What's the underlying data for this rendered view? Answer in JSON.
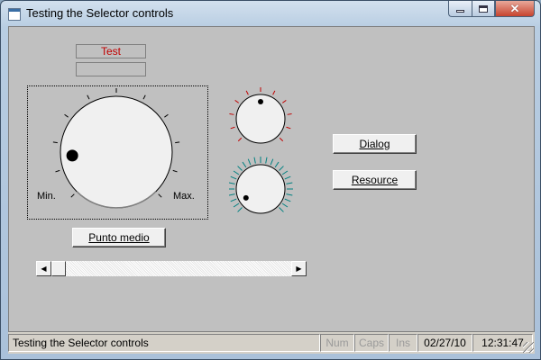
{
  "window": {
    "title": "Testing the Selector controls"
  },
  "form": {
    "text_top": "Test",
    "text_bottom": ""
  },
  "big_dial": {
    "min_label": "Min.",
    "max_label": "Max.",
    "ticks": 11,
    "value": 0.15
  },
  "small_dial_top": {
    "ticks": 11,
    "value": 0.5,
    "tick_color": "#c00000"
  },
  "small_dial_bottom": {
    "ticks": 25,
    "value": 0.05,
    "tick_color": "#008080"
  },
  "buttons": {
    "punto_medio": "Punto medio",
    "dialog": "Dialog",
    "resource": "Resource"
  },
  "scrollbar": {
    "position": 0
  },
  "status": {
    "message": "Testing the Selector controls",
    "num": "Num",
    "caps": "Caps",
    "ins": "Ins",
    "date": "02/27/10",
    "time": "12:31:47"
  }
}
